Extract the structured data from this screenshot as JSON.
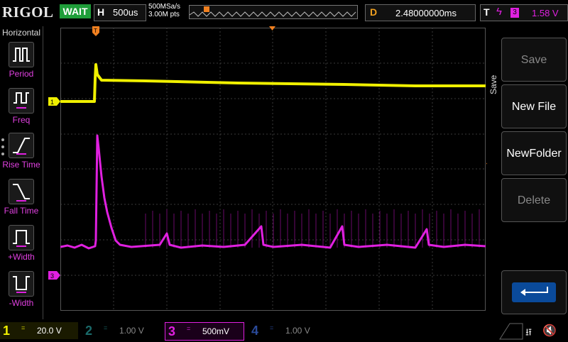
{
  "header": {
    "brand": "RIGOL",
    "status": "WAIT",
    "timebase_label": "H",
    "timebase_value": "500us",
    "sample_rate": "500MSa/s",
    "memory_depth": "3.00M pts",
    "delay_label": "D",
    "delay_value": "2.48000000ms",
    "trigger_label": "T",
    "trigger_source": "3",
    "trigger_level": "1.58 V"
  },
  "left_menu": {
    "title": "Horizontal",
    "items": [
      {
        "label": "Period",
        "icon": "period-icon"
      },
      {
        "label": "Freq",
        "icon": "frequency-icon"
      },
      {
        "label": "Rise Time",
        "icon": "rise-time-icon"
      },
      {
        "label": "Fall Time",
        "icon": "fall-time-icon"
      },
      {
        "label": "+Width",
        "icon": "positive-width-icon"
      },
      {
        "label": "-Width",
        "icon": "negative-width-icon"
      }
    ]
  },
  "right_menu": {
    "title": "Save",
    "buttons": [
      {
        "label": "Save",
        "enabled": false
      },
      {
        "label": "New File",
        "enabled": true
      },
      {
        "label": "NewFolder",
        "enabled": true
      },
      {
        "label": "Delete",
        "enabled": false
      },
      {
        "label": "",
        "icon": "return-icon",
        "enabled": true
      }
    ]
  },
  "channels": [
    {
      "number": "1",
      "coupling": "=",
      "scale": "20.0 V",
      "active": true,
      "color": "#f0f000"
    },
    {
      "number": "2",
      "coupling": "=",
      "scale": "1.00 V",
      "active": false,
      "color": "#1a6a6a"
    },
    {
      "number": "3",
      "coupling": "=",
      "scale": "500mV",
      "active": true,
      "color": "#e020e0"
    },
    {
      "number": "4",
      "coupling": "=",
      "scale": "1.00 V",
      "active": false,
      "color": "#1a3a8a"
    }
  ],
  "markers": {
    "ch1": "1",
    "ch3": "3",
    "trigger": "T"
  },
  "colors": {
    "ch1": "#f0f000",
    "ch3": "#e020e0",
    "trigger": "#f08020",
    "grid": "#3a3a3a"
  }
}
